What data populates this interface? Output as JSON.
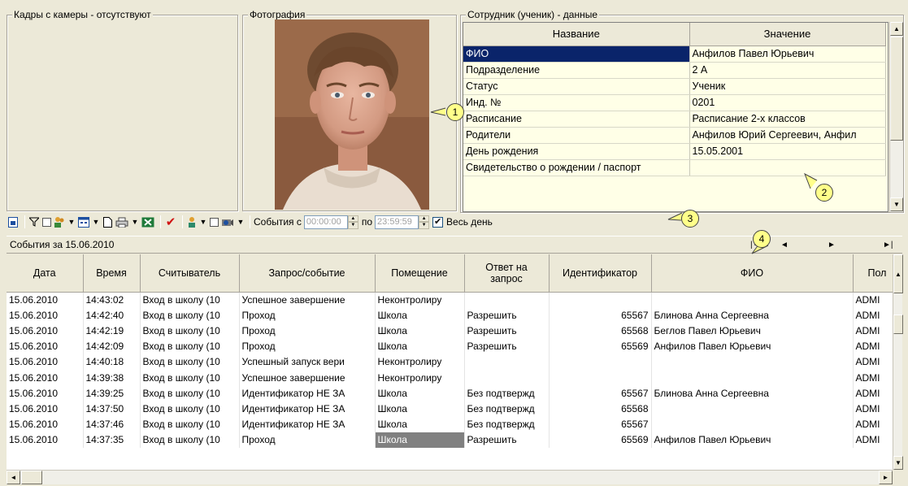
{
  "camera_group": {
    "title": "Кадры с камеры - отсутствуют"
  },
  "photo_group": {
    "title": "Фотография"
  },
  "employee_group": {
    "title": "Сотрудник (ученик) - данные",
    "headers": {
      "name": "Название",
      "value": "Значение"
    },
    "rows": [
      {
        "name": "ФИО",
        "value": "Анфилов Павел Юрьевич"
      },
      {
        "name": "Подразделение",
        "value": "2 А"
      },
      {
        "name": "Статус",
        "value": "Ученик"
      },
      {
        "name": "Инд. №",
        "value": "0201"
      },
      {
        "name": "Расписание",
        "value": "Расписание 2-х классов"
      },
      {
        "name": "Родители",
        "value": "Анфилов Юрий Сергеевич, Анфил"
      },
      {
        "name": "День рождения",
        "value": "15.05.2001"
      },
      {
        "name": "Свидетельство о рождении / паспорт",
        "value": ""
      }
    ]
  },
  "callouts": {
    "c1": "1",
    "c2": "2",
    "c3": "3",
    "c4": "4"
  },
  "toolbar": {
    "events_from_label": "События с",
    "from_value": "00:00:00",
    "to_label": "по",
    "to_value": "23:59:59",
    "whole_day_label": "Весь день",
    "whole_day_checked": true,
    "check_mark": "✔"
  },
  "events": {
    "caption": "События за 15.06.2010",
    "headers": [
      "Дата",
      "Время",
      "Считыватель",
      "Запрос/событие",
      "Помещение",
      "Ответ на запрос",
      "Идентификатор",
      "ФИО",
      "Пол"
    ],
    "rows": [
      [
        "15.06.2010",
        "14:43:02",
        "Вход в школу (10",
        "Успешное завершение",
        "Неконтролиру",
        "",
        "",
        "",
        "ADMI"
      ],
      [
        "15.06.2010",
        "14:42:40",
        "Вход в школу (10",
        "Проход",
        "Школа",
        "Разрешить",
        "65567",
        "Блинова Анна Сергеевна",
        "ADMI"
      ],
      [
        "15.06.2010",
        "14:42:19",
        "Вход в школу (10",
        "Проход",
        "Школа",
        "Разрешить",
        "65568",
        "Беглов Павел Юрьевич",
        "ADMI"
      ],
      [
        "15.06.2010",
        "14:42:09",
        "Вход в школу (10",
        "Проход",
        "Школа",
        "Разрешить",
        "65569",
        "Анфилов Павел Юрьевич",
        "ADMI"
      ],
      [
        "15.06.2010",
        "14:40:18",
        "Вход в школу (10",
        "Успешный запуск вери",
        "Неконтролиру",
        "",
        "",
        "",
        "ADMI"
      ],
      [
        "15.06.2010",
        "14:39:38",
        "Вход в школу (10",
        "Успешное завершение",
        "Неконтролиру",
        "",
        "",
        "",
        "ADMI"
      ],
      [
        "15.06.2010",
        "14:39:25",
        "Вход в школу (10",
        "Идентификатор НЕ ЗА",
        "Школа",
        "Без подтвержд",
        "65567",
        "Блинова Анна Сергеевна",
        "ADMI"
      ],
      [
        "15.06.2010",
        "14:37:50",
        "Вход в школу (10",
        "Идентификатор НЕ ЗА",
        "Школа",
        "Без подтвержд",
        "65568",
        "",
        "ADMI"
      ],
      [
        "15.06.2010",
        "14:37:46",
        "Вход в школу (10",
        "Идентификатор НЕ ЗА",
        "Школа",
        "Без подтвержд",
        "65567",
        "",
        "ADMI"
      ],
      [
        "15.06.2010",
        "14:37:35",
        "Вход в школу (10",
        "Проход",
        "Школа",
        "Разрешить",
        "65569",
        "Анфилов Павел Юрьевич",
        "ADMI"
      ]
    ]
  }
}
